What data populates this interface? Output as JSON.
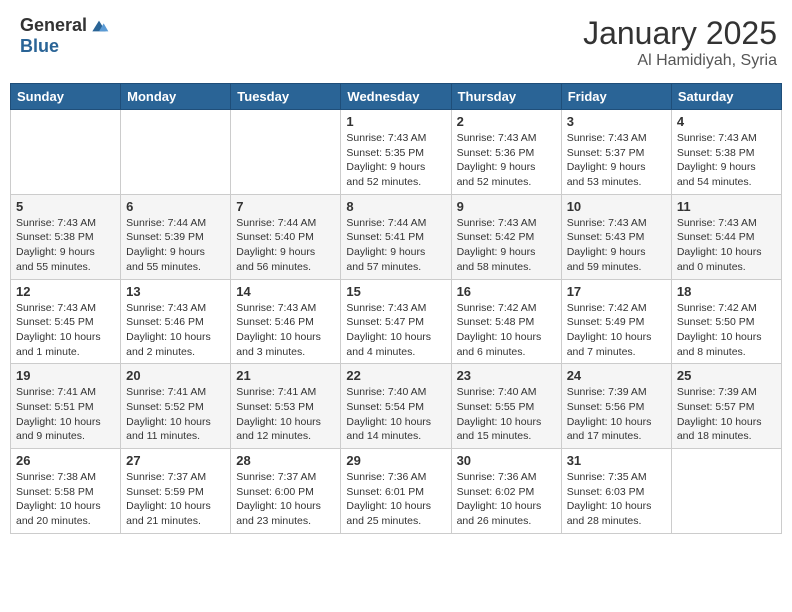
{
  "header": {
    "logo_general": "General",
    "logo_blue": "Blue",
    "month": "January 2025",
    "location": "Al Hamidiyah, Syria"
  },
  "weekdays": [
    "Sunday",
    "Monday",
    "Tuesday",
    "Wednesday",
    "Thursday",
    "Friday",
    "Saturday"
  ],
  "weeks": [
    [
      {
        "day": "",
        "info": ""
      },
      {
        "day": "",
        "info": ""
      },
      {
        "day": "",
        "info": ""
      },
      {
        "day": "1",
        "info": "Sunrise: 7:43 AM\nSunset: 5:35 PM\nDaylight: 9 hours\nand 52 minutes."
      },
      {
        "day": "2",
        "info": "Sunrise: 7:43 AM\nSunset: 5:36 PM\nDaylight: 9 hours\nand 52 minutes."
      },
      {
        "day": "3",
        "info": "Sunrise: 7:43 AM\nSunset: 5:37 PM\nDaylight: 9 hours\nand 53 minutes."
      },
      {
        "day": "4",
        "info": "Sunrise: 7:43 AM\nSunset: 5:38 PM\nDaylight: 9 hours\nand 54 minutes."
      }
    ],
    [
      {
        "day": "5",
        "info": "Sunrise: 7:43 AM\nSunset: 5:38 PM\nDaylight: 9 hours\nand 55 minutes."
      },
      {
        "day": "6",
        "info": "Sunrise: 7:44 AM\nSunset: 5:39 PM\nDaylight: 9 hours\nand 55 minutes."
      },
      {
        "day": "7",
        "info": "Sunrise: 7:44 AM\nSunset: 5:40 PM\nDaylight: 9 hours\nand 56 minutes."
      },
      {
        "day": "8",
        "info": "Sunrise: 7:44 AM\nSunset: 5:41 PM\nDaylight: 9 hours\nand 57 minutes."
      },
      {
        "day": "9",
        "info": "Sunrise: 7:43 AM\nSunset: 5:42 PM\nDaylight: 9 hours\nand 58 minutes."
      },
      {
        "day": "10",
        "info": "Sunrise: 7:43 AM\nSunset: 5:43 PM\nDaylight: 9 hours\nand 59 minutes."
      },
      {
        "day": "11",
        "info": "Sunrise: 7:43 AM\nSunset: 5:44 PM\nDaylight: 10 hours\nand 0 minutes."
      }
    ],
    [
      {
        "day": "12",
        "info": "Sunrise: 7:43 AM\nSunset: 5:45 PM\nDaylight: 10 hours\nand 1 minute."
      },
      {
        "day": "13",
        "info": "Sunrise: 7:43 AM\nSunset: 5:46 PM\nDaylight: 10 hours\nand 2 minutes."
      },
      {
        "day": "14",
        "info": "Sunrise: 7:43 AM\nSunset: 5:46 PM\nDaylight: 10 hours\nand 3 minutes."
      },
      {
        "day": "15",
        "info": "Sunrise: 7:43 AM\nSunset: 5:47 PM\nDaylight: 10 hours\nand 4 minutes."
      },
      {
        "day": "16",
        "info": "Sunrise: 7:42 AM\nSunset: 5:48 PM\nDaylight: 10 hours\nand 6 minutes."
      },
      {
        "day": "17",
        "info": "Sunrise: 7:42 AM\nSunset: 5:49 PM\nDaylight: 10 hours\nand 7 minutes."
      },
      {
        "day": "18",
        "info": "Sunrise: 7:42 AM\nSunset: 5:50 PM\nDaylight: 10 hours\nand 8 minutes."
      }
    ],
    [
      {
        "day": "19",
        "info": "Sunrise: 7:41 AM\nSunset: 5:51 PM\nDaylight: 10 hours\nand 9 minutes."
      },
      {
        "day": "20",
        "info": "Sunrise: 7:41 AM\nSunset: 5:52 PM\nDaylight: 10 hours\nand 11 minutes."
      },
      {
        "day": "21",
        "info": "Sunrise: 7:41 AM\nSunset: 5:53 PM\nDaylight: 10 hours\nand 12 minutes."
      },
      {
        "day": "22",
        "info": "Sunrise: 7:40 AM\nSunset: 5:54 PM\nDaylight: 10 hours\nand 14 minutes."
      },
      {
        "day": "23",
        "info": "Sunrise: 7:40 AM\nSunset: 5:55 PM\nDaylight: 10 hours\nand 15 minutes."
      },
      {
        "day": "24",
        "info": "Sunrise: 7:39 AM\nSunset: 5:56 PM\nDaylight: 10 hours\nand 17 minutes."
      },
      {
        "day": "25",
        "info": "Sunrise: 7:39 AM\nSunset: 5:57 PM\nDaylight: 10 hours\nand 18 minutes."
      }
    ],
    [
      {
        "day": "26",
        "info": "Sunrise: 7:38 AM\nSunset: 5:58 PM\nDaylight: 10 hours\nand 20 minutes."
      },
      {
        "day": "27",
        "info": "Sunrise: 7:37 AM\nSunset: 5:59 PM\nDaylight: 10 hours\nand 21 minutes."
      },
      {
        "day": "28",
        "info": "Sunrise: 7:37 AM\nSunset: 6:00 PM\nDaylight: 10 hours\nand 23 minutes."
      },
      {
        "day": "29",
        "info": "Sunrise: 7:36 AM\nSunset: 6:01 PM\nDaylight: 10 hours\nand 25 minutes."
      },
      {
        "day": "30",
        "info": "Sunrise: 7:36 AM\nSunset: 6:02 PM\nDaylight: 10 hours\nand 26 minutes."
      },
      {
        "day": "31",
        "info": "Sunrise: 7:35 AM\nSunset: 6:03 PM\nDaylight: 10 hours\nand 28 minutes."
      },
      {
        "day": "",
        "info": ""
      }
    ]
  ]
}
